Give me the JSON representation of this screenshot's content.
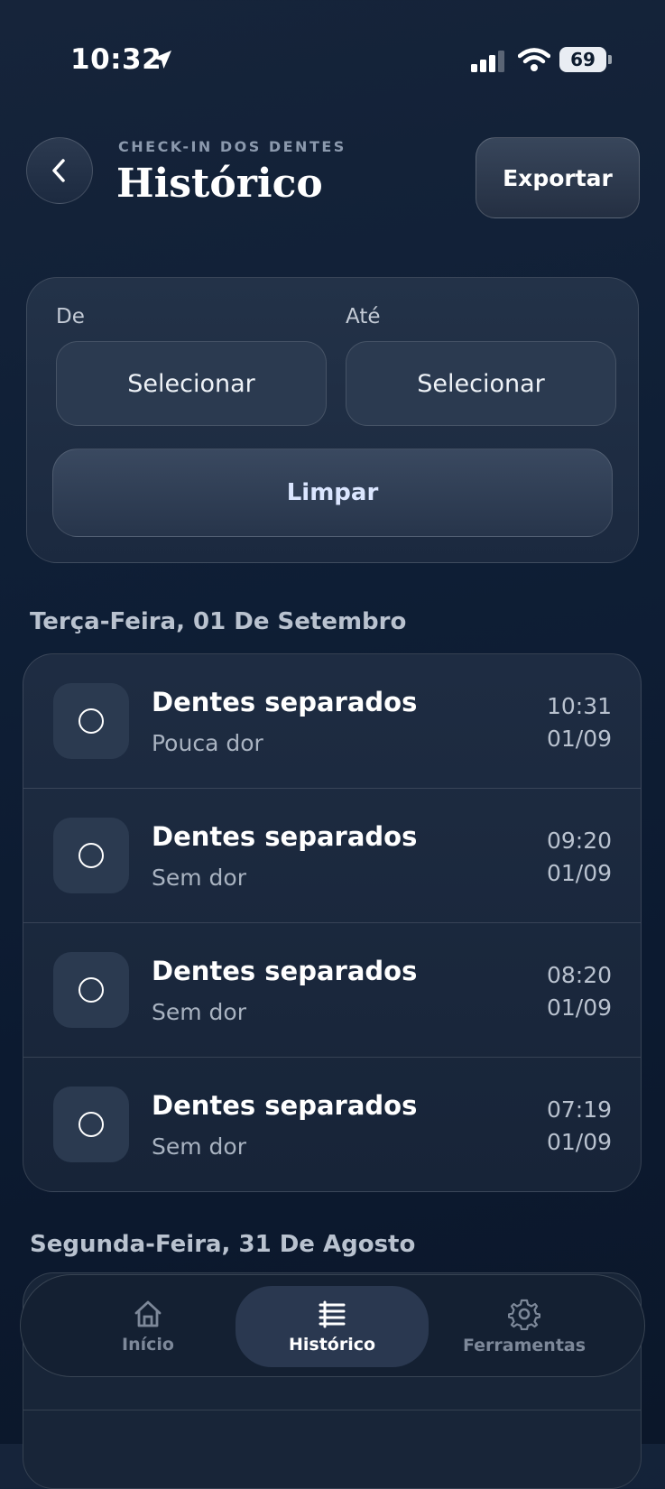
{
  "status_bar": {
    "time": "10:32",
    "battery": "69"
  },
  "header": {
    "kicker": "CHECK-IN DOS DENTES",
    "title": "Histórico",
    "export_label": "Exportar"
  },
  "filter": {
    "from_label": "De",
    "to_label": "Até",
    "from_value": "Selecionar",
    "to_value": "Selecionar",
    "clear_label": "Limpar"
  },
  "days": [
    {
      "heading": "Terça-Feira, 01 De Setembro",
      "entries": [
        {
          "title": "Dentes separados",
          "subtitle": "Pouca dor",
          "time": "10:31",
          "date": "01/09"
        },
        {
          "title": "Dentes separados",
          "subtitle": "Sem dor",
          "time": "09:20",
          "date": "01/09"
        },
        {
          "title": "Dentes separados",
          "subtitle": "Sem dor",
          "time": "08:20",
          "date": "01/09"
        },
        {
          "title": "Dentes separados",
          "subtitle": "Sem dor",
          "time": "07:19",
          "date": "01/09"
        }
      ]
    },
    {
      "heading": "Segunda-Feira, 31 De Agosto"
    }
  ],
  "tabs": [
    {
      "label": "Início",
      "icon": "home-icon"
    },
    {
      "label": "Histórico",
      "icon": "list-icon",
      "active": true
    },
    {
      "label": "Ferramentas",
      "icon": "gear-icon"
    }
  ]
}
